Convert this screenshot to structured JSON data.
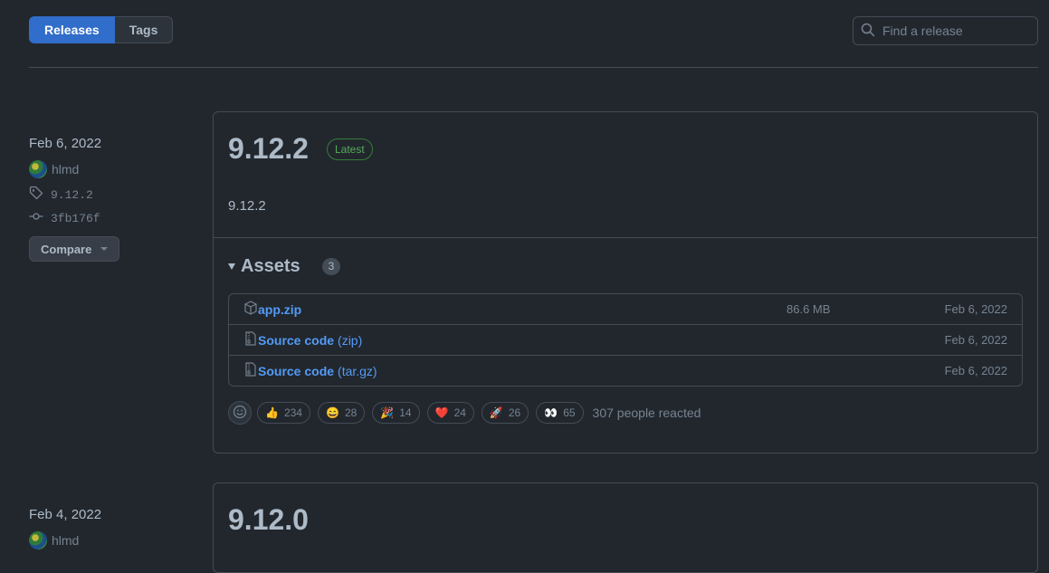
{
  "tabs": {
    "releases": "Releases",
    "tags": "Tags"
  },
  "search": {
    "placeholder": "Find a release"
  },
  "releases": [
    {
      "date": "Feb 6, 2022",
      "author": "hlmd",
      "tag": "9.12.2",
      "commit": "3fb176f",
      "compare_label": "Compare",
      "version": "9.12.2",
      "badge": "Latest",
      "body": "9.12.2",
      "assets_label": "Assets",
      "assets_count": "3",
      "assets": [
        {
          "name": "app.zip",
          "suffix": "",
          "size": "86.6 MB",
          "date": "Feb 6, 2022",
          "icon": "package-icon"
        },
        {
          "name": "Source code",
          "suffix": "(zip)",
          "size": "",
          "date": "Feb 6, 2022",
          "icon": "file-zip-icon"
        },
        {
          "name": "Source code",
          "suffix": "(tar.gz)",
          "size": "",
          "date": "Feb 6, 2022",
          "icon": "file-zip-icon"
        }
      ],
      "reactions": [
        {
          "emoji": "👍",
          "count": "234"
        },
        {
          "emoji": "😄",
          "count": "28"
        },
        {
          "emoji": "🎉",
          "count": "14"
        },
        {
          "emoji": "❤️",
          "count": "24"
        },
        {
          "emoji": "🚀",
          "count": "26"
        },
        {
          "emoji": "👀",
          "count": "65"
        }
      ],
      "reacted_text": "307 people reacted"
    },
    {
      "date": "Feb 4, 2022",
      "author": "hlmd",
      "version": "9.12.0"
    }
  ],
  "colors": {
    "background": "#22272e",
    "accent": "#316dca",
    "link": "#539bf5",
    "latest_green": "#57ab5a"
  }
}
